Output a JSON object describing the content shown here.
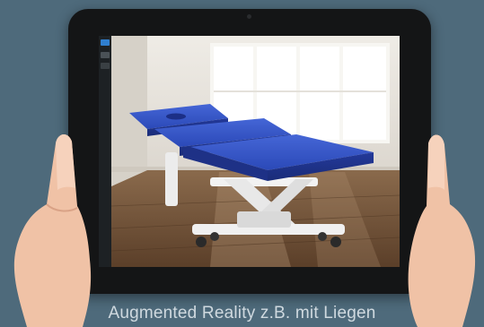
{
  "caption": "Augmented Reality z.B. mit Liegen",
  "colors": {
    "background": "#4e6a7b",
    "tablet_frame": "#141516",
    "table_upholstery": "#2b49b8",
    "toolbar_active": "#2f7fd0",
    "floor": "#7a5b3f"
  },
  "icons": {
    "toolbar_button": "toolbar-button-icon"
  }
}
